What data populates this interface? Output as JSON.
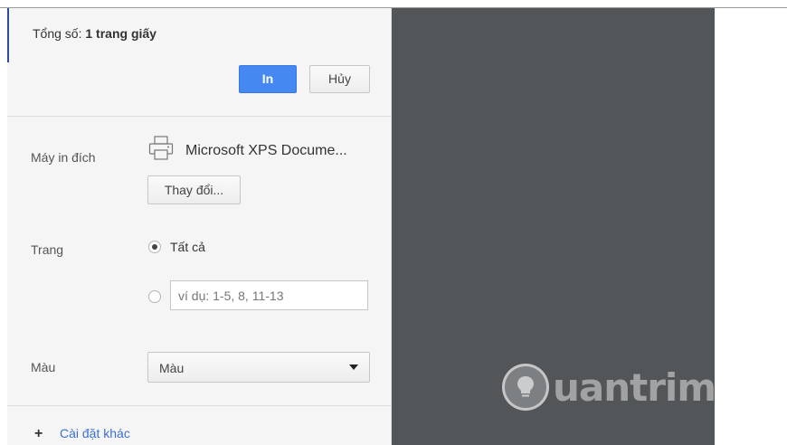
{
  "summary": {
    "total_prefix": "Tổng số: ",
    "total_value": "1 trang giấy"
  },
  "buttons": {
    "print_label": "In",
    "cancel_label": "Hủy",
    "change_label": "Thay đổi..."
  },
  "destination": {
    "label": "Máy in đích",
    "name": "Microsoft XPS Docume...",
    "icon": "printer-icon"
  },
  "pages": {
    "label": "Trang",
    "option_all": "Tất cả",
    "option_all_selected": true,
    "custom_placeholder": "ví dụ: 1-5, 8, 11-13",
    "custom_value": ""
  },
  "color": {
    "label": "Màu",
    "selected": "Màu"
  },
  "more_settings": {
    "label": "Cài đặt khác"
  },
  "watermark": {
    "text": "uantrimang"
  },
  "colors": {
    "accent": "#4688f1",
    "preview_bg": "#525659",
    "sidebar_bg": "#f5f5f5",
    "link": "#3b6fd1"
  }
}
